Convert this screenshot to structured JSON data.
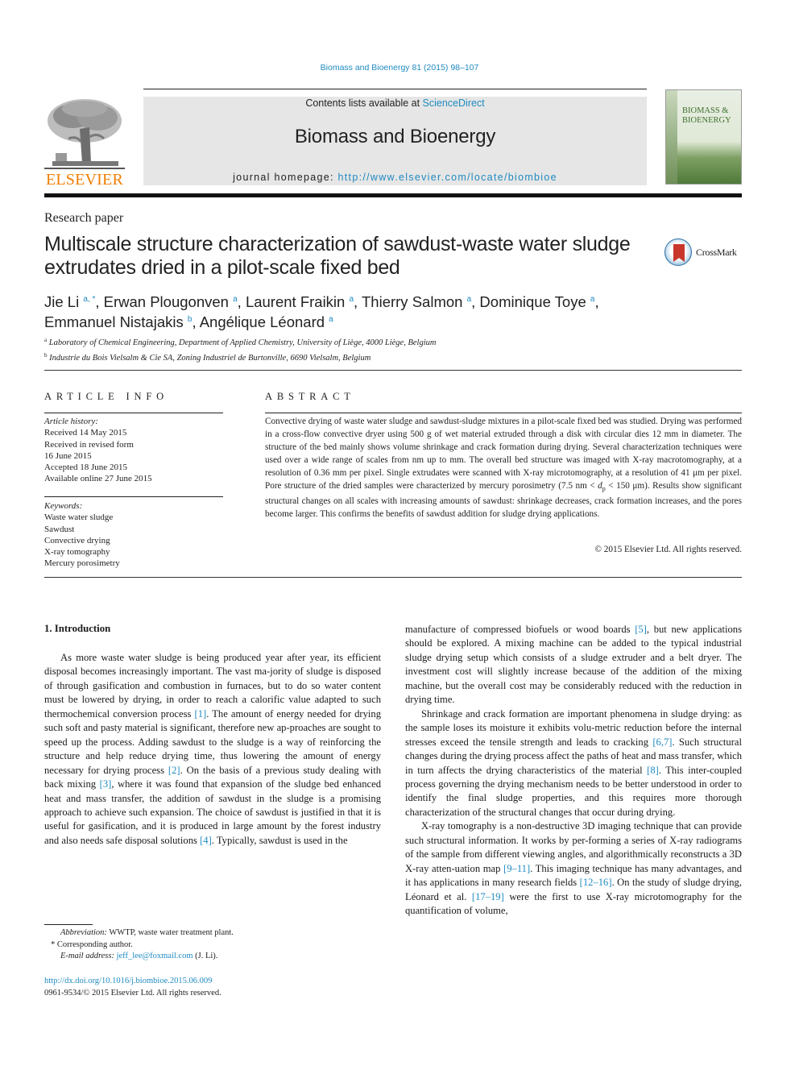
{
  "running_head": "Biomass and Bioenergy 81 (2015) 98–107",
  "header": {
    "publisher_logo_text": "ELSEVIER",
    "contents_prefix": "Contents lists available at ",
    "contents_link": "ScienceDirect",
    "journal_name": "Biomass and Bioenergy",
    "homepage_prefix": "journal homepage: ",
    "homepage_url": "http://www.elsevier.com/locate/biombioe",
    "cover_title_line1": "BIOMASS &",
    "cover_title_line2": "BIOENERGY"
  },
  "crossmark_label": "CrossMark",
  "section_type": "Research paper",
  "title_line1": "Multiscale structure characterization of sawdust-waste water sludge",
  "title_line2": "extrudates dried in a pilot-scale fixed bed",
  "authors": [
    {
      "name": "Jie Li",
      "sup": "a, *",
      "sep": ", "
    },
    {
      "name": "Erwan Plougonven",
      "sup": "a",
      "sep": ", "
    },
    {
      "name": "Laurent Fraikin",
      "sup": "a",
      "sep": ", "
    },
    {
      "name": "Thierry Salmon",
      "sup": "a",
      "sep": ", "
    },
    {
      "name": "Dominique Toye",
      "sup": "a",
      "sep": ","
    },
    {
      "name": "Emmanuel Nistajakis",
      "sup": "b",
      "sep": ", "
    },
    {
      "name": "Angélique Léonard",
      "sup": "a",
      "sep": ""
    }
  ],
  "affiliations": [
    {
      "mark": "a",
      "text": "Laboratory of Chemical Engineering, Department of Applied Chemistry, University of Liège, 4000 Liège, Belgium"
    },
    {
      "mark": "b",
      "text": "Industrie du Bois Vielsalm & Cie SA, Zoning Industriel de Burtonville, 6690 Vielsalm, Belgium"
    }
  ],
  "article_info": {
    "heading": "ARTICLE INFO",
    "history_label": "Article history:",
    "history": [
      "Received 14 May 2015",
      "Received in revised form",
      "16 June 2015",
      "Accepted 18 June 2015",
      "Available online 27 June 2015"
    ],
    "keywords_label": "Keywords:",
    "keywords": [
      "Waste water sludge",
      "Sawdust",
      "Convective drying",
      "X-ray tomography",
      "Mercury porosimetry"
    ]
  },
  "abstract": {
    "heading": "ABSTRACT",
    "text_part1": "Convective drying of waste water sludge and sawdust-sludge mixtures in a pilot-scale fixed bed was studied. Drying was performed in a cross-flow convective dryer using 500 g of wet material extruded through a disk with circular dies 12 mm in diameter. The structure of the bed mainly shows volume shrinkage and crack formation during drying. Several characterization techniques were used over a wide range of scales from nm up to mm. The overall bed structure was imaged with X-ray macrotomography, at a resolution of 0.36 mm per pixel. Single extrudates were scanned with X-ray microtomography, at a resolution of 41 μm per pixel. Pore structure of the dried samples were characterized by mercury porosimetry (7.5 nm < ",
    "text_var": "d",
    "text_sub": "p",
    "text_part2": " < 150 μm). Results show significant structural changes on all scales with increasing amounts of sawdust: shrinkage decreases, crack formation increases, and the pores become larger. This confirms the benefits of sawdust addition for sludge drying applications.",
    "copyright": "© 2015 Elsevier Ltd. All rights reserved."
  },
  "body": {
    "section_heading": "1.  Introduction",
    "left_p1": [
      {
        "t": "As more waste water sludge is being produced year after year, its efficient disposal becomes increasingly important. The vast ma-jority of sludge is disposed of through gasification and combustion in furnaces, but to do so water content must be lowered by drying, in order to reach a calorific value adapted to such thermochemical conversion process "
      },
      {
        "ref": "[1]"
      },
      {
        "t": ". The amount of energy needed for drying such soft and pasty material is significant, therefore new ap-proaches are sought to speed up the process. Adding sawdust to the sludge is a way of reinforcing the structure and help reduce drying time, thus lowering the amount of energy necessary for drying process "
      },
      {
        "ref": "[2]"
      },
      {
        "t": ". On the basis of a previous study dealing with back mixing "
      },
      {
        "ref": "[3]"
      },
      {
        "t": ", where it was found that expansion of the sludge bed enhanced heat and mass transfer, the addition of sawdust in the sludge is a promising approach to achieve such expansion. The choice of sawdust is justified in that it is useful for gasification, and it is produced in large amount by the forest industry and also needs safe disposal solutions "
      },
      {
        "ref": "[4]"
      },
      {
        "t": ". Typically, sawdust is used in the"
      }
    ],
    "right_p1": [
      {
        "t": "manufacture of compressed biofuels or wood boards "
      },
      {
        "ref": "[5]"
      },
      {
        "t": ", but new applications should be explored. A mixing machine can be added to the typical industrial sludge drying setup which consists of a sludge extruder and a belt dryer. The investment cost will slightly increase because of the addition of the mixing machine, but the overall cost may be considerably reduced with the reduction in drying time."
      }
    ],
    "right_p2": [
      {
        "t": "Shrinkage and crack formation are important phenomena in sludge drying: as the sample loses its moisture it exhibits volu-metric reduction before the internal stresses exceed the tensile strength and leads to cracking "
      },
      {
        "ref": "[6,7]"
      },
      {
        "t": ". Such structural changes during the drying process affect the paths of heat and mass transfer, which in turn affects the drying characteristics of the material "
      },
      {
        "ref": "[8]"
      },
      {
        "t": ". This inter-coupled process governing the drying mechanism needs to be better understood in order to identify the final sludge properties, and this requires more thorough characterization of the structural changes that occur during drying."
      }
    ],
    "right_p3": [
      {
        "t": "X-ray tomography is a non-destructive 3D imaging technique that can provide such structural information. It works by per-forming a series of X-ray radiograms of the sample from different viewing angles, and algorithmically reconstructs a 3D X-ray atten-uation map "
      },
      {
        "ref": "[9–11]"
      },
      {
        "t": ". This imaging technique has many advantages, and it has applications in many research fields "
      },
      {
        "ref": "[12–16]"
      },
      {
        "t": ". On the study of sludge drying, Léonard et al. "
      },
      {
        "ref": "[17–19]"
      },
      {
        "t": " were the first to use X-ray microtomography for the quantification of volume,"
      }
    ]
  },
  "footnotes": {
    "abbrev_label": "Abbreviation:",
    "abbrev_text": " WWTP, waste water treatment plant.",
    "corresponding_mark": "*",
    "corresponding_text": " Corresponding author.",
    "email_label": "E-mail address:",
    "email": "jeff_lee@foxmail.com",
    "email_suffix": " (J. Li)."
  },
  "doi": "http://dx.doi.org/10.1016/j.biombioe.2015.06.009",
  "issn_line": "0961-9534/© 2015 Elsevier Ltd. All rights reserved.",
  "colors": {
    "link": "#1f8ac0",
    "elsevier_orange": "#f07d00",
    "header_gray": "#e6e6e6"
  }
}
